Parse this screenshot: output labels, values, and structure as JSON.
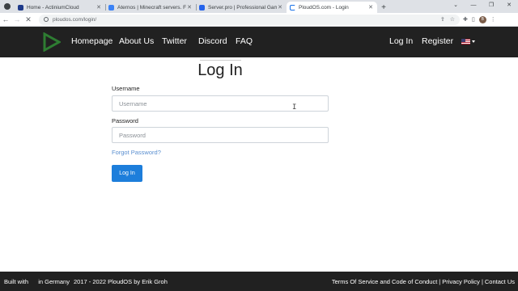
{
  "browser": {
    "tabs": [
      {
        "title": "Home - ActiniumCloud",
        "active": false
      },
      {
        "title": "Aternos | Minecraft servers. Free",
        "active": false
      },
      {
        "title": "Server.pro | Professional Game S",
        "active": false
      },
      {
        "title": "PloudOS.com - Login",
        "active": true
      }
    ],
    "new_tab": "+",
    "url": "ploudos.com/login/",
    "profile_initial": "B"
  },
  "navbar": {
    "links": [
      "Homepage",
      "About Us",
      "Twitter",
      "Discord",
      "FAQ"
    ],
    "login": "Log In",
    "register": "Register",
    "language_icon": "us-flag-icon"
  },
  "form": {
    "title": "Log In",
    "username_label": "Username",
    "username_placeholder": "Username",
    "password_label": "Password",
    "password_placeholder": "Password",
    "forgot": "Forgot Password?",
    "submit": "Log In"
  },
  "footer": {
    "built_with": "Built with",
    "in_germany": "in Germany",
    "copyright": "2017 - 2022 PloudOS by Erik Groh",
    "links": [
      "Terms Of Service and Code of Conduct",
      "Privacy Policy",
      "Contact Us"
    ]
  },
  "colors": {
    "nav_bg": "#212121",
    "logo_green": "#2e7d32",
    "button_blue": "#1d7edb",
    "link_blue": "#5a8fd0"
  }
}
